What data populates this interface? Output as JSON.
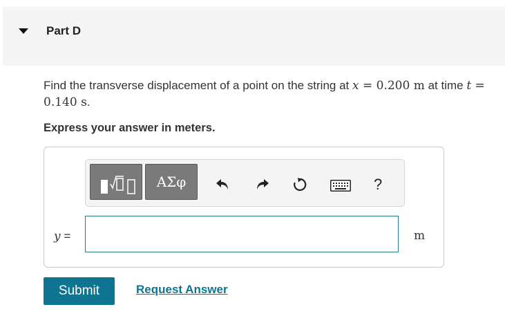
{
  "part": {
    "title": "Part D"
  },
  "question": {
    "text_before": "Find the transverse displacement of a point on the string at ",
    "x_var": "x",
    "equals1": " = ",
    "x_value": "0.200 m",
    "text_mid": " at time ",
    "t_var": "t",
    "equals2": " = ",
    "t_value": "0.140 s",
    "text_end": "."
  },
  "instruction": "Express your answer in meters.",
  "toolbar": {
    "greek_label": "ΑΣφ",
    "help_label": "?",
    "icons": [
      "template-icon",
      "greek-letters",
      "undo-icon",
      "redo-icon",
      "reset-icon",
      "keyboard-icon",
      "help-icon"
    ]
  },
  "answer": {
    "variable": "y",
    "equals": " =",
    "value": "",
    "unit": "m"
  },
  "actions": {
    "submit_label": "Submit",
    "request_label": "Request Answer"
  },
  "colors": {
    "accent": "#0e7490",
    "header_bg": "#f5f5f5",
    "button_gray": "#7a7a7a"
  }
}
